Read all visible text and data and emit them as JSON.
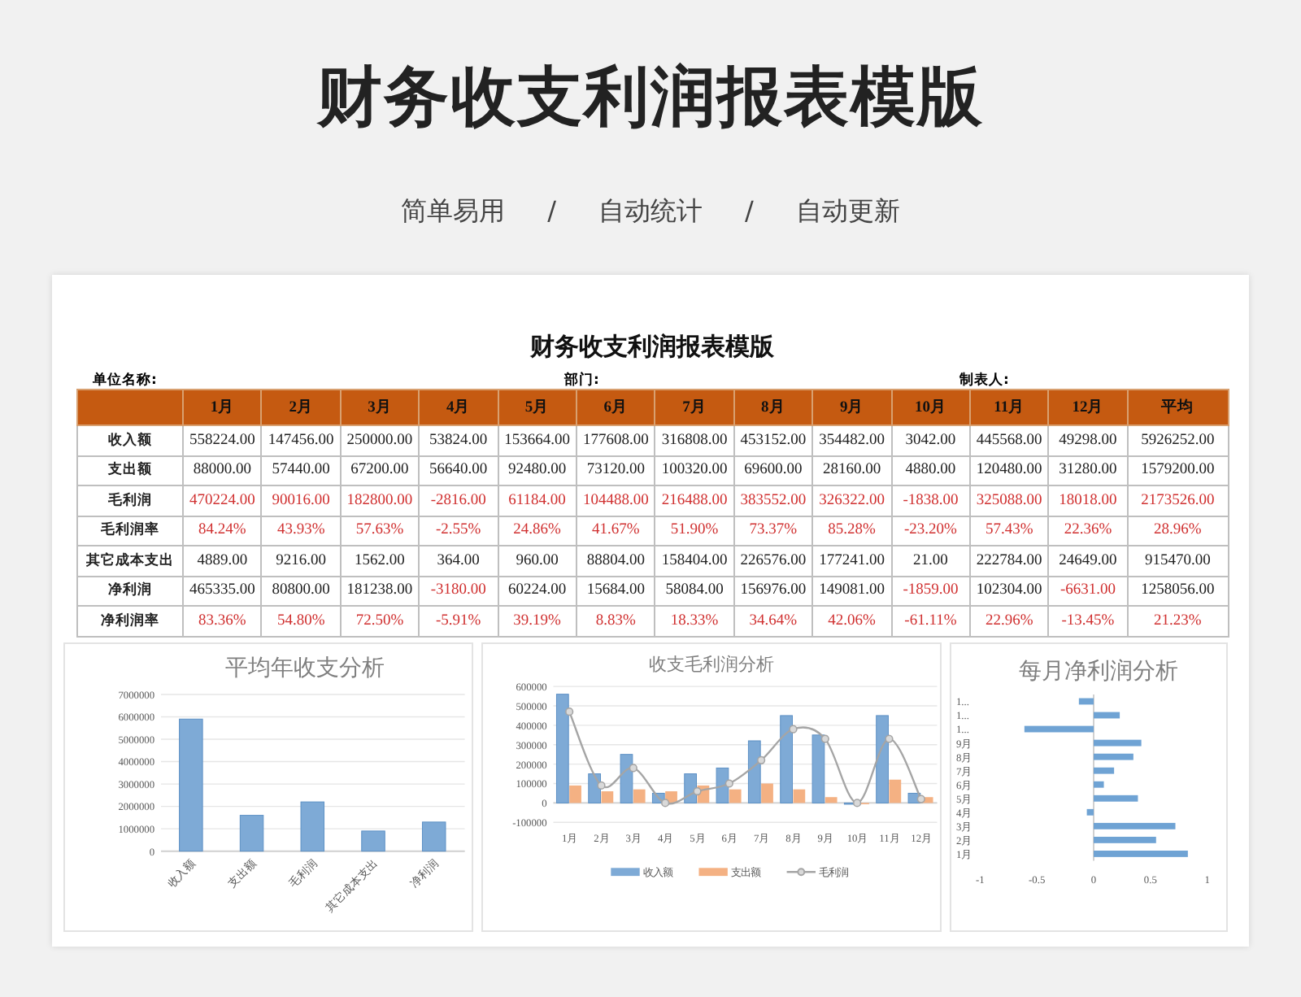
{
  "header": {
    "title": "财务收支利润报表模版",
    "tagline": {
      "items": [
        "简单易用",
        "自动统计",
        "自动更新"
      ],
      "separator": "/"
    }
  },
  "sheet": {
    "title": "财务收支利润报表模版",
    "meta": [
      "单位名称:",
      "部门:",
      "制表人:"
    ],
    "table": {
      "columns": [
        "1月",
        "2月",
        "3月",
        "4月",
        "5月",
        "6月",
        "7月",
        "8月",
        "9月",
        "10月",
        "11月",
        "12月",
        "平均"
      ],
      "rows": [
        {
          "label": "收入额",
          "cells": [
            "558224.00",
            "147456.00",
            "250000.00",
            "53824.00",
            "153664.00",
            "177608.00",
            "316808.00",
            "453152.00",
            "354482.00",
            "3042.00",
            "445568.00",
            "49298.00",
            "5926252.00"
          ],
          "red_cells": [
            false,
            false,
            false,
            false,
            false,
            false,
            false,
            false,
            false,
            false,
            false,
            false,
            false
          ]
        },
        {
          "label": "支出额",
          "cells": [
            "88000.00",
            "57440.00",
            "67200.00",
            "56640.00",
            "92480.00",
            "73120.00",
            "100320.00",
            "69600.00",
            "28160.00",
            "4880.00",
            "120480.00",
            "31280.00",
            "1579200.00"
          ],
          "red_cells": [
            false,
            false,
            false,
            false,
            false,
            false,
            false,
            false,
            false,
            false,
            false,
            false,
            false
          ]
        },
        {
          "label": "毛利润",
          "cells": [
            "470224.00",
            "90016.00",
            "182800.00",
            "-2816.00",
            "61184.00",
            "104488.00",
            "216488.00",
            "383552.00",
            "326322.00",
            "-1838.00",
            "325088.00",
            "18018.00",
            "2173526.00"
          ],
          "red_cells": [
            true,
            true,
            true,
            true,
            true,
            true,
            true,
            true,
            true,
            true,
            true,
            true,
            true
          ]
        },
        {
          "label": "毛利润率",
          "cells": [
            "84.24%",
            "43.93%",
            "57.63%",
            "-2.55%",
            "24.86%",
            "41.67%",
            "51.90%",
            "73.37%",
            "85.28%",
            "-23.20%",
            "57.43%",
            "22.36%",
            "28.96%"
          ],
          "red_cells": [
            true,
            true,
            true,
            true,
            true,
            true,
            true,
            true,
            true,
            true,
            true,
            true,
            true
          ]
        },
        {
          "label": "其它成本支出",
          "cells": [
            "4889.00",
            "9216.00",
            "1562.00",
            "364.00",
            "960.00",
            "88804.00",
            "158404.00",
            "226576.00",
            "177241.00",
            "21.00",
            "222784.00",
            "24649.00",
            "915470.00"
          ],
          "red_cells": [
            false,
            false,
            false,
            false,
            false,
            false,
            false,
            false,
            false,
            false,
            false,
            false,
            false
          ]
        },
        {
          "label": "净利润",
          "cells": [
            "465335.00",
            "80800.00",
            "181238.00",
            "-3180.00",
            "60224.00",
            "15684.00",
            "58084.00",
            "156976.00",
            "149081.00",
            "-1859.00",
            "102304.00",
            "-6631.00",
            "1258056.00"
          ],
          "red_cells": [
            false,
            false,
            false,
            true,
            false,
            false,
            false,
            false,
            false,
            true,
            false,
            true,
            false
          ]
        },
        {
          "label": "净利润率",
          "cells": [
            "83.36%",
            "54.80%",
            "72.50%",
            "-5.91%",
            "39.19%",
            "8.83%",
            "18.33%",
            "34.64%",
            "42.06%",
            "-61.11%",
            "22.96%",
            "-13.45%",
            "21.23%"
          ],
          "red_cells": [
            true,
            true,
            true,
            true,
            true,
            true,
            true,
            true,
            true,
            true,
            true,
            true,
            true
          ]
        }
      ]
    },
    "charts": [
      {
        "chart_data": {
          "type": "bar",
          "title": "平均年收支分析",
          "categories": [
            "收入额",
            "支出额",
            "毛利润",
            "其它成本支出",
            "净利润"
          ],
          "grid": true,
          "series": [
            {
              "color": "#7eaad6",
              "values": [
                5900000,
                1600000,
                2200000,
                900000,
                1300000
              ]
            }
          ],
          "ylim": [
            0,
            7000000
          ],
          "yticks": [
            0,
            1000000,
            2000000,
            3000000,
            4000000,
            5000000,
            6000000,
            7000000
          ]
        }
      },
      {
        "chart_data": {
          "type": "bar",
          "title": "收支毛利润分析",
          "categories": [
            "1月",
            "2月",
            "3月",
            "4月",
            "5月",
            "6月",
            "7月",
            "8月",
            "9月",
            "10月",
            "11月",
            "12月"
          ],
          "grid": true,
          "legend": true,
          "series": [
            {
              "name": "收入额",
              "color": "#7eaad6",
              "values": [
                560000,
                150000,
                250000,
                50000,
                150000,
                180000,
                320000,
                450000,
                350000,
                0,
                450000,
                50000
              ]
            },
            {
              "name": "支出额",
              "color": "#f4b183",
              "values": [
                90000,
                60000,
                70000,
                60000,
                90000,
                70000,
                100000,
                70000,
                30000,
                0,
                120000,
                30000
              ]
            },
            {
              "name": "毛利润",
              "color": "#a5a5a5",
              "type": "line",
              "marker": "circle",
              "values": [
                470000,
                90000,
                180000,
                0,
                60000,
                100000,
                220000,
                380000,
                330000,
                0,
                330000,
                20000
              ]
            }
          ],
          "ylim": [
            -100000,
            600000
          ],
          "yticks": [
            -100000,
            0,
            100000,
            200000,
            300000,
            400000,
            500000,
            600000
          ]
        }
      },
      {
        "chart_data": {
          "type": "bar",
          "orientation": "horizontal",
          "title": "每月净利润分析",
          "categories": [
            "1...",
            "1...",
            "1...",
            "9月",
            "8月",
            "7月",
            "6月",
            "5月",
            "4月",
            "3月",
            "2月",
            "1月"
          ],
          "series": [
            {
              "color": "#6fa3d4",
              "values": [
                -0.13,
                0.23,
                -0.61,
                0.42,
                0.35,
                0.18,
                0.09,
                0.39,
                -0.06,
                0.72,
                0.55,
                0.83
              ]
            }
          ],
          "xlim": [
            -1,
            1
          ],
          "xticks": [
            -1,
            -0.5,
            0,
            0.5,
            1
          ]
        }
      }
    ]
  }
}
